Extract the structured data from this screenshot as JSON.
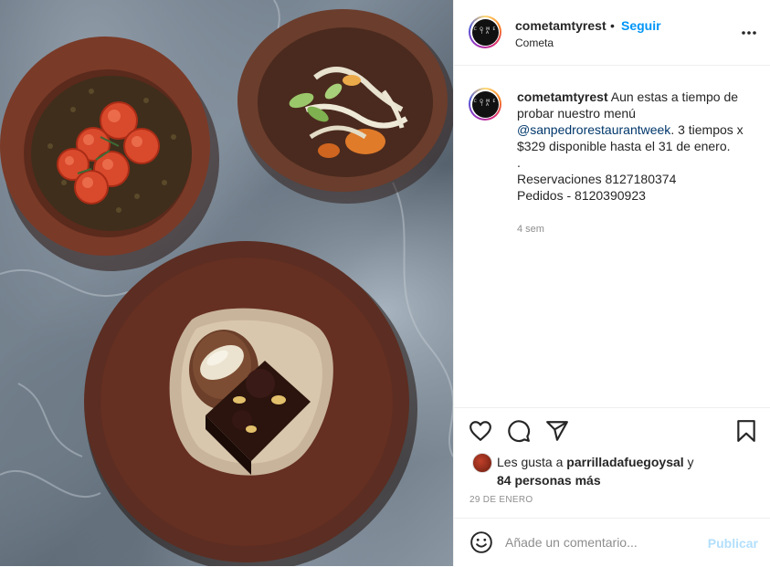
{
  "post": {
    "username": "cometamtyrest",
    "dot": "•",
    "follow_label": "Seguir",
    "location": "Cometa",
    "avatar_text": "C O M E T A"
  },
  "caption": {
    "username": "cometamtyrest",
    "text_before": " Aun estas a tiempo de probar nuestro menú ",
    "mention": "@sanpedrorestaurantweek",
    "text_after": ". 3 tiempos x $329 disponible hasta el 31 de enero.",
    "separator": ".",
    "reservations": "Reservaciones 8127180374",
    "orders": "Pedidos - 8120390923",
    "time_ago": "4 sem"
  },
  "actions": {
    "icons": [
      "heart-icon",
      "comment-icon",
      "share-icon",
      "bookmark-icon"
    ]
  },
  "likes": {
    "prefix": "Les gusta a ",
    "user": "parrilladafuegoysal",
    "middle": " y",
    "count_text": "84 personas más"
  },
  "date": "29 DE ENERO",
  "comment": {
    "placeholder": "Añade un comentario...",
    "publish_label": "Publicar"
  },
  "colors": {
    "accent": "#0095f6",
    "publish_disabled": "#b2dffc",
    "text": "#262626",
    "muted": "#8e8e8e"
  }
}
